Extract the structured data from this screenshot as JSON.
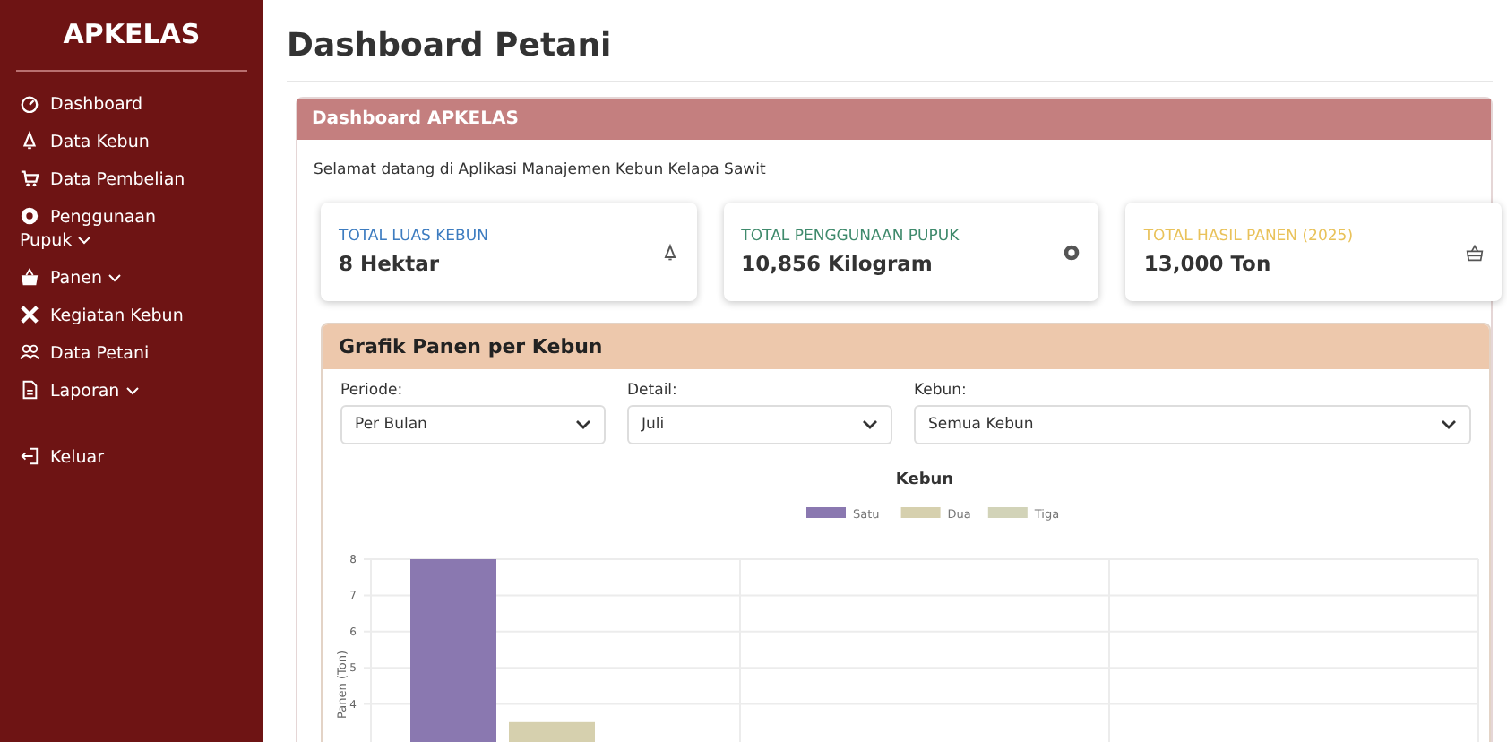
{
  "sidebar": {
    "brand": "APKELAS",
    "items": [
      {
        "label": "Dashboard",
        "dropdown": false
      },
      {
        "label": "Data Kebun",
        "dropdown": false
      },
      {
        "label": "Data Pembelian",
        "dropdown": false
      },
      {
        "label": "Penggunaan Pupuk",
        "dropdown": true
      },
      {
        "label": "Panen",
        "dropdown": true
      },
      {
        "label": "Kegiatan Kebun",
        "dropdown": false
      },
      {
        "label": "Data Petani",
        "dropdown": false
      },
      {
        "label": "Laporan",
        "dropdown": true
      }
    ],
    "logout": "Keluar"
  },
  "page_title": "Dashboard Petani",
  "panel": {
    "title": "Dashboard APKELAS",
    "welcome": "Selamat datang di Aplikasi Manajemen Kebun Kelapa Sawit",
    "stats": [
      {
        "label": "TOTAL LUAS KEBUN",
        "value": "8 Hektar",
        "color": "#3d7cc0"
      },
      {
        "label": "TOTAL PENGGUNAAN PUPUK",
        "value": "10,856 Kilogram",
        "color": "#3f8a6c"
      },
      {
        "label": "TOTAL HASIL PANEN (2025)",
        "value": "13,000 Ton",
        "color": "#e9c25a"
      }
    ]
  },
  "chart_panel": {
    "title": "Grafik Panen per Kebun",
    "filters": [
      {
        "label": "Periode:",
        "value": "Per Bulan"
      },
      {
        "label": "Detail:",
        "value": "Juli"
      },
      {
        "label": "Kebun:",
        "value": "Semua Kebun"
      }
    ],
    "chart_data": {
      "type": "bar",
      "grid": true,
      "legend": "top",
      "title": "Kebun",
      "ylabel": "Panen (Ton)",
      "ylim": [
        0,
        8
      ],
      "yticks": [
        4,
        5,
        6,
        7,
        8
      ],
      "series": [
        {
          "name": "Satu",
          "color": "#8a78b0",
          "values": [
            8,
            null,
            null
          ]
        },
        {
          "name": "Dua",
          "color": "#d6d0ae",
          "values": [
            3.5,
            null,
            null
          ]
        },
        {
          "name": "Tiga",
          "color": "#d2d3b8",
          "values": [
            null,
            null,
            null
          ]
        }
      ]
    }
  }
}
